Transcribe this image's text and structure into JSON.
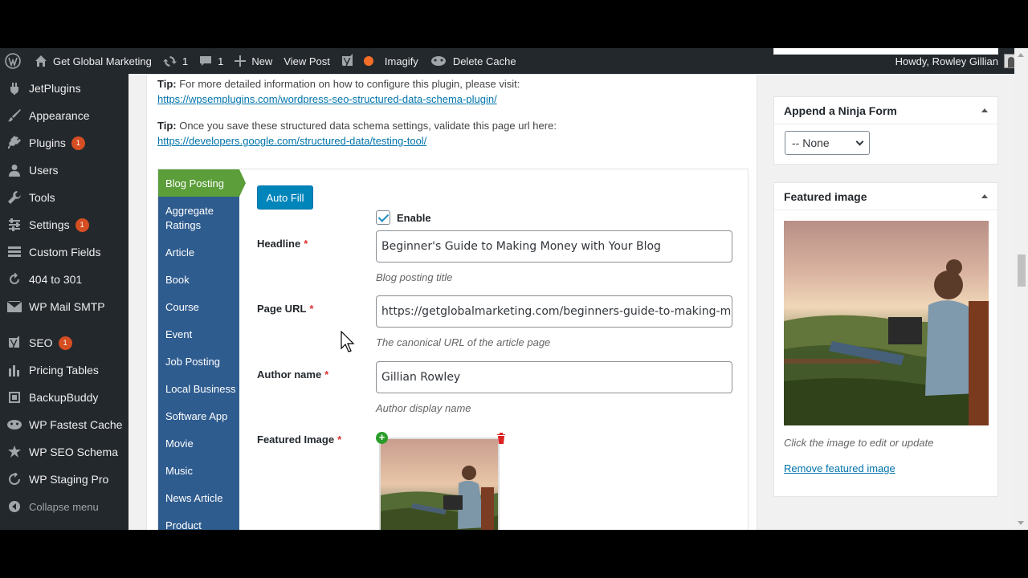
{
  "adminbar": {
    "site_name": "Get Global Marketing",
    "updates_count": "1",
    "comments_count": "1",
    "new_label": "New",
    "view_post_label": "View Post",
    "imagify_label": "Imagify",
    "delete_cache_label": "Delete Cache",
    "howdy": "Howdy, Rowley Gillian"
  },
  "sidebar": {
    "items": [
      {
        "label": "JetPlugins",
        "icon": "plugin-icon"
      },
      {
        "label": "Appearance",
        "icon": "brush-icon"
      },
      {
        "label": "Plugins",
        "icon": "plug-icon",
        "badge": "1"
      },
      {
        "label": "Users",
        "icon": "user-icon"
      },
      {
        "label": "Tools",
        "icon": "wrench-icon"
      },
      {
        "label": "Settings",
        "icon": "settings-icon",
        "badge": "1"
      },
      {
        "label": "Custom Fields",
        "icon": "fields-icon"
      },
      {
        "label": "404 to 301",
        "icon": "redirect-icon"
      },
      {
        "label": "WP Mail SMTP",
        "icon": "mail-icon"
      },
      {
        "label": "SEO",
        "icon": "yoast-icon",
        "badge": "1"
      },
      {
        "label": "Pricing Tables",
        "icon": "chart-icon"
      },
      {
        "label": "BackupBuddy",
        "icon": "backup-icon"
      },
      {
        "label": "WP Fastest Cache",
        "icon": "cheetah-icon"
      },
      {
        "label": "WP SEO Schema",
        "icon": "schema-icon"
      },
      {
        "label": "WP Staging Pro",
        "icon": "staging-icon"
      }
    ],
    "collapse_label": "Collapse menu"
  },
  "tips": {
    "tip_label": "Tip:",
    "tip1_text": "For more detailed information on how to configure this plugin, please visit:",
    "tip1_link": "https://wpsemplugins.com/wordpress-seo-structured-data-schema-plugin/",
    "tip2_text": "Once you save these structured data schema settings, validate this page url here:",
    "tip2_link": "https://developers.google.com/structured-data/testing-tool/"
  },
  "schema_tabs": [
    "Blog Posting",
    "Aggregate Ratings",
    "Article",
    "Book",
    "Course",
    "Event",
    "Job Posting",
    "Local Business",
    "Software App",
    "Movie",
    "Music",
    "News Article",
    "Product"
  ],
  "form": {
    "auto_fill_label": "Auto Fill",
    "enable_label": "Enable",
    "enable_checked": true,
    "required_mark": "*",
    "headline_label": "Headline",
    "headline_value": "Beginner's Guide to Making Money with Your Blog",
    "headline_help": "Blog posting title",
    "page_url_label": "Page URL",
    "page_url_value": "https://getglobalmarketing.com/beginners-guide-to-making-money-w",
    "page_url_help": "The canonical URL of the article page",
    "author_label": "Author name",
    "author_value": "Gillian Rowley",
    "author_help": "Author display name",
    "featured_image_label": "Featured Image"
  },
  "right": {
    "ninja_title": "Append a Ninja Form",
    "ninja_selected": "-- None",
    "featured_title": "Featured image",
    "featured_help": "Click the image to edit or update",
    "remove_link": "Remove featured image"
  }
}
